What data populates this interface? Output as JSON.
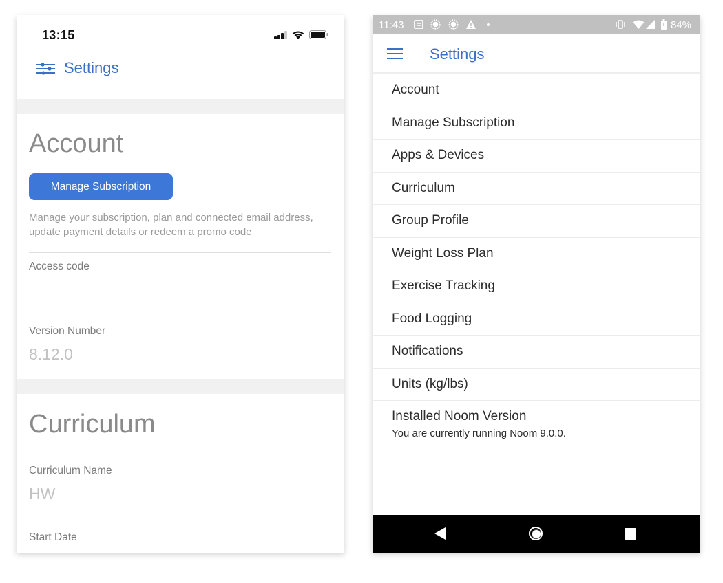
{
  "ios": {
    "status_bar": {
      "time": "13:15"
    },
    "header": {
      "icon": "sliders-icon",
      "title": "Settings"
    },
    "account": {
      "title": "Account",
      "manage_button_label": "Manage Subscription",
      "description": "Manage your subscription, plan and connected email address, update payment details or redeem a promo code",
      "access_code_label": "Access code",
      "access_code_value": "",
      "version_label": "Version Number",
      "version_value": "8.12.0"
    },
    "curriculum": {
      "title": "Curriculum",
      "name_label": "Curriculum Name",
      "name_value": "HW",
      "start_date_label": "Start Date"
    },
    "colors": {
      "accent": "#3b70c8",
      "button": "#3d78d8"
    }
  },
  "android": {
    "status_bar": {
      "time": "11:43",
      "left_icons": [
        "notes-icon",
        "record-icon",
        "record-icon",
        "warning-icon",
        "dot-icon"
      ],
      "right_icons": [
        "vibrate-icon",
        "wifi-icon",
        "cell-signal-icon",
        "battery-icon"
      ],
      "battery_percent": "84%"
    },
    "appbar": {
      "menu_icon": "hamburger-menu-icon",
      "title": "Settings"
    },
    "menu_items": [
      {
        "label": "Account"
      },
      {
        "label": "Manage Subscription"
      },
      {
        "label": "Apps & Devices"
      },
      {
        "label": "Curriculum"
      },
      {
        "label": "Group Profile"
      },
      {
        "label": "Weight Loss Plan"
      },
      {
        "label": "Exercise Tracking"
      },
      {
        "label": "Food Logging"
      },
      {
        "label": "Notifications"
      },
      {
        "label": "Units (kg/lbs)"
      }
    ],
    "installed_version": {
      "title": "Installed Noom Version",
      "subtitle": "You are currently running Noom 9.0.0."
    },
    "nav_bar": [
      "back-icon",
      "home-icon",
      "recents-icon"
    ]
  }
}
